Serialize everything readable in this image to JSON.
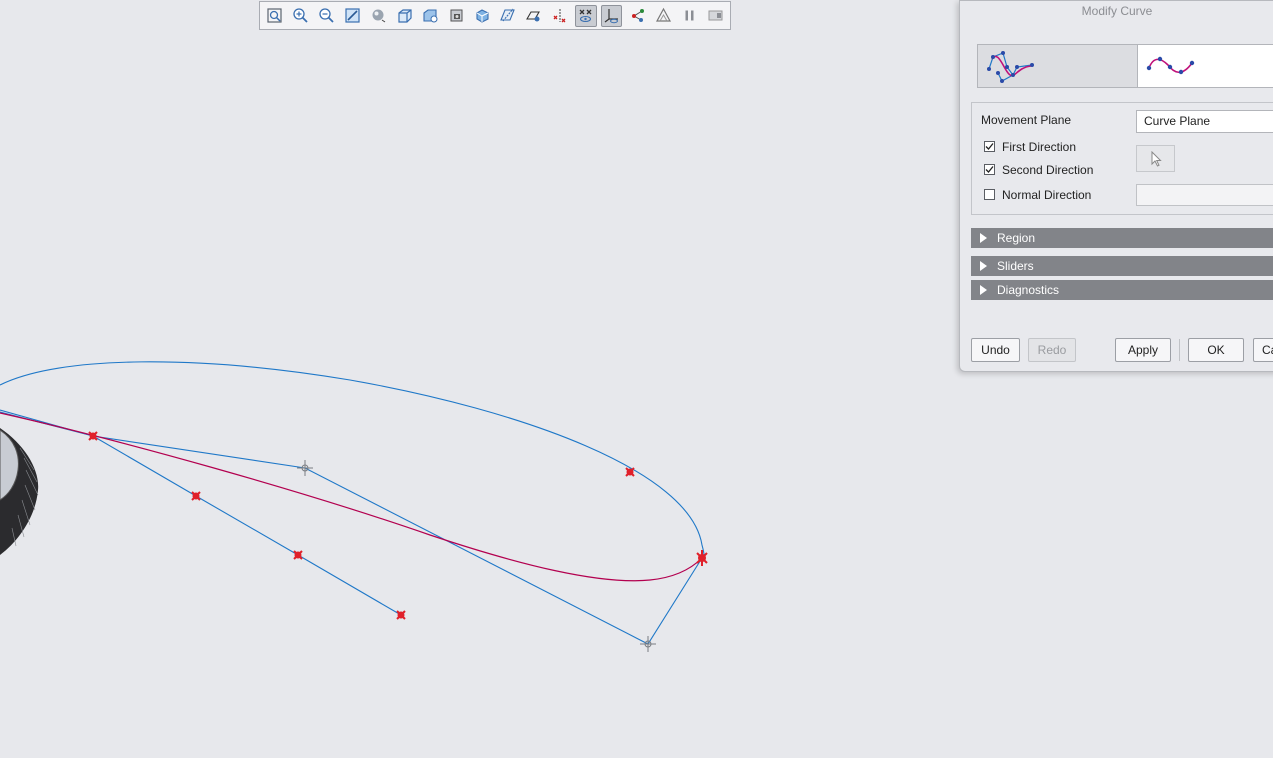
{
  "toolbar": {
    "items": [
      {
        "icon": "refit-icon"
      },
      {
        "icon": "zoom-in-icon"
      },
      {
        "icon": "zoom-out-icon"
      },
      {
        "icon": "repaint-icon"
      },
      {
        "icon": "display-style-icon"
      },
      {
        "icon": "saved-views-icon"
      },
      {
        "icon": "view-manager-icon"
      },
      {
        "icon": "perspective-icon"
      },
      {
        "icon": "spin-center-icon"
      },
      {
        "icon": "plane-display-icon"
      },
      {
        "icon": "axis-display-icon"
      },
      {
        "icon": "point-display-icon"
      },
      {
        "icon": "point-tag-display-icon",
        "active": true
      },
      {
        "icon": "csys-display-icon",
        "active": true
      },
      {
        "icon": "annotation-display-icon"
      },
      {
        "icon": "simulation-display-icon"
      },
      {
        "icon": "pause-icon"
      },
      {
        "icon": "regenerate-icon"
      }
    ]
  },
  "dialog": {
    "title": "Modify Curve",
    "tabs": [
      {
        "icon": "control-polygon-icon",
        "selected": true
      },
      {
        "icon": "interpolation-points-icon",
        "selected": false
      }
    ],
    "movement_plane_label": "Movement Plane",
    "movement_plane_value": "Curve Plane",
    "directions": [
      {
        "label": "First Direction",
        "checked": true
      },
      {
        "label": "Second Direction",
        "checked": true
      },
      {
        "label": "Normal Direction",
        "checked": false
      }
    ],
    "sections": [
      "Region",
      "Sliders",
      "Diagnostics"
    ],
    "buttons": {
      "undo": "Undo",
      "redo": "Redo",
      "apply": "Apply",
      "ok": "OK",
      "cancel": "Ca"
    }
  },
  "colors": {
    "curve_blue": "#1f78c8",
    "curve_magenta": "#b3004f",
    "point_red": "#e0202a",
    "background": "#e7e8ec"
  }
}
